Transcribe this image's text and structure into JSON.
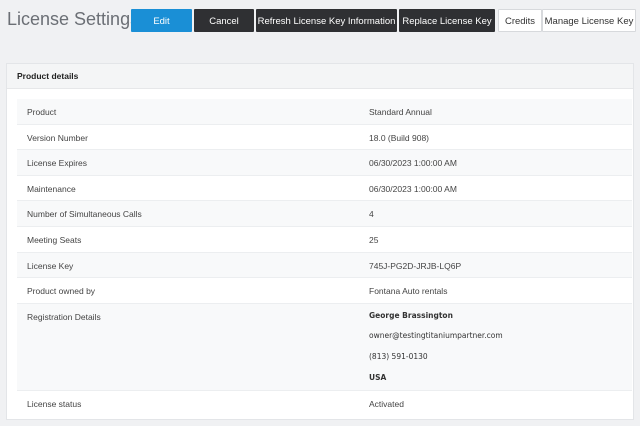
{
  "header": {
    "title": "License Settings",
    "buttons": {
      "edit": "Edit",
      "cancel": "Cancel",
      "refresh": "Refresh License Key Information",
      "replace": "Replace License Key",
      "credits": "Credits",
      "manage": "Manage License Key"
    }
  },
  "card": {
    "title": "Product details",
    "rows": [
      {
        "label": "Product",
        "value": "Standard Annual"
      },
      {
        "label": "Version Number",
        "value": "18.0 (Build 908)"
      },
      {
        "label": "License Expires",
        "value": "06/30/2023 1:00:00 AM"
      },
      {
        "label": "Maintenance",
        "value": "06/30/2023 1:00:00 AM"
      },
      {
        "label": "Number of Simultaneous Calls",
        "value": "4"
      },
      {
        "label": "Meeting Seats",
        "value": "25"
      },
      {
        "label": "License Key",
        "value": "745J-PG2D-JRJB-LQ6P"
      },
      {
        "label": "Product owned by",
        "value": "Fontana Auto rentals"
      }
    ],
    "registration": {
      "label": "Registration Details",
      "name": "George Brassington",
      "email": "owner@testingtitaniumpartner.com",
      "phone": "(813) 591-0130",
      "country": "USA"
    },
    "status": {
      "label": "License status",
      "value": "Activated"
    }
  },
  "colors": {
    "primary": "#1a8fd6",
    "dark_button": "#2f3033",
    "background": "#f0f1f3"
  }
}
